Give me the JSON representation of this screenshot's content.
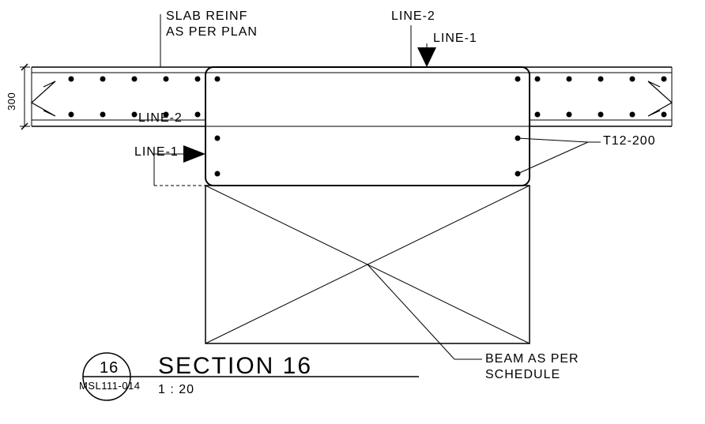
{
  "labels": {
    "slab_reinf_l1": "SLAB REINF",
    "slab_reinf_l2": "AS PER PLAN",
    "line2_top": "LINE-2",
    "line1_top": "LINE-1",
    "line2_left": "LINE-2",
    "line1_left": "LINE-1",
    "t12": "T12-200",
    "dim_300": "300",
    "beam_l1": "BEAM AS PER",
    "beam_l2": "SCHEDULE",
    "section_title": "SECTION 16",
    "scale": "1 : 20",
    "circle_num": "16",
    "sheet_ref": "MSL111-014"
  }
}
